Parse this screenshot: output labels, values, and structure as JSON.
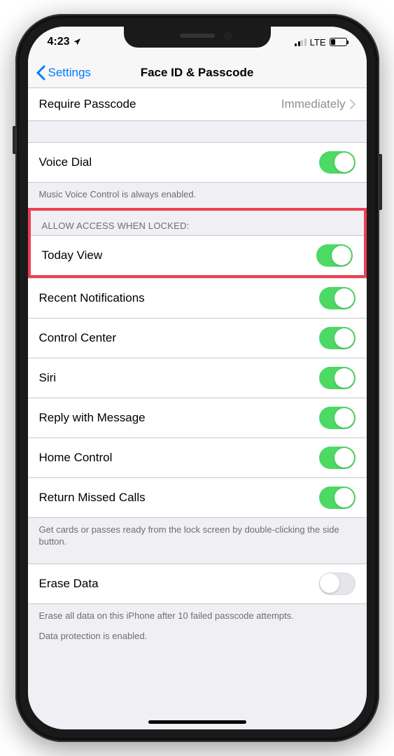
{
  "statusBar": {
    "time": "4:23",
    "network": "LTE"
  },
  "nav": {
    "back": "Settings",
    "title": "Face ID & Passcode"
  },
  "rows": {
    "requirePasscode": {
      "label": "Require Passcode",
      "value": "Immediately"
    },
    "voiceDial": {
      "label": "Voice Dial",
      "on": true
    },
    "voiceDialFooter": "Music Voice Control is always enabled.",
    "allowAccessHeader": "ALLOW ACCESS WHEN LOCKED:",
    "todayView": {
      "label": "Today View",
      "on": true
    },
    "recentNotifications": {
      "label": "Recent Notifications",
      "on": true
    },
    "controlCenter": {
      "label": "Control Center",
      "on": true
    },
    "siri": {
      "label": "Siri",
      "on": true
    },
    "replyWithMessage": {
      "label": "Reply with Message",
      "on": true
    },
    "homeControl": {
      "label": "Home Control",
      "on": true
    },
    "returnMissedCalls": {
      "label": "Return Missed Calls",
      "on": true
    },
    "walletFooter": "Get cards or passes ready from the lock screen by double-clicking the side button.",
    "eraseData": {
      "label": "Erase Data",
      "on": false
    },
    "eraseFooter1": "Erase all data on this iPhone after 10 failed passcode attempts.",
    "eraseFooter2": "Data protection is enabled."
  }
}
